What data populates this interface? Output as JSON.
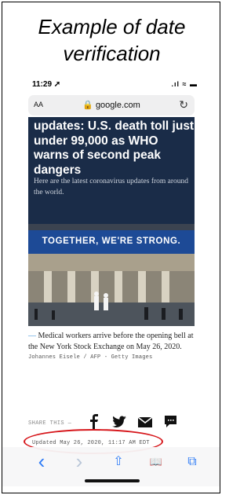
{
  "caption": {
    "line1": "Example of date",
    "line2": "verification"
  },
  "status_bar": {
    "time": "11:29 ➚",
    "indicators": ".ıl ≈ ▬"
  },
  "browser": {
    "text_size_label": "AA",
    "url": "🔒 google.com",
    "reload_icon": "↻"
  },
  "article": {
    "headline": "updates: U.S. death toll just under 99,000 as WHO warns of second peak dangers",
    "dek": "Here are the latest coronavirus updates from around the world.",
    "banner_text": "TOGETHER, WE'RE STRONG.",
    "photo_caption_dash": "—",
    "photo_caption": "Medical workers arrive before the opening bell at the New York Stock Exchange on May 26, 2020.",
    "photo_credit": "Johannes Eisele / AFP - Getty Images",
    "share_label": "SHARE THIS —",
    "updated": "Updated May 26, 2020, 11:17 AM EDT"
  },
  "toolbar": {
    "back": "‹",
    "forward": "›",
    "share": "⇧",
    "bookmarks": "📖",
    "tabs": "⧉"
  },
  "colors": {
    "headline_bg": "#1a2c48",
    "banner_bg": "#1d4a96",
    "highlight_oval": "#d6151a",
    "link_blue": "#2f7cf6"
  }
}
